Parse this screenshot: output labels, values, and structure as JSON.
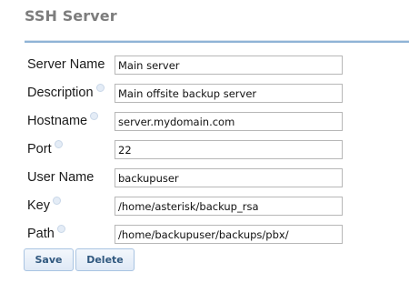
{
  "panel": {
    "title": "SSH Server"
  },
  "fields": [
    {
      "label": "Server Name",
      "value": "Main server",
      "help": false
    },
    {
      "label": "Description",
      "value": "Main offsite backup server",
      "help": true
    },
    {
      "label": "Hostname",
      "value": "server.mydomain.com",
      "help": true
    },
    {
      "label": "Port",
      "value": "22",
      "help": true
    },
    {
      "label": "User Name",
      "value": "backupuser",
      "help": false
    },
    {
      "label": "Key",
      "value": "/home/asterisk/backup_rsa",
      "help": true
    },
    {
      "label": "Path",
      "value": "/home/backupuser/backups/pbx/",
      "help": true
    }
  ],
  "actions": {
    "save_label": "Save",
    "delete_label": "Delete"
  },
  "icons": {
    "help": "help-icon"
  },
  "colors": {
    "title_text": "#7d7d7d",
    "rule_accent": "#8fb3d6",
    "button_text": "#30587f",
    "button_border": "#a9c4e2"
  }
}
